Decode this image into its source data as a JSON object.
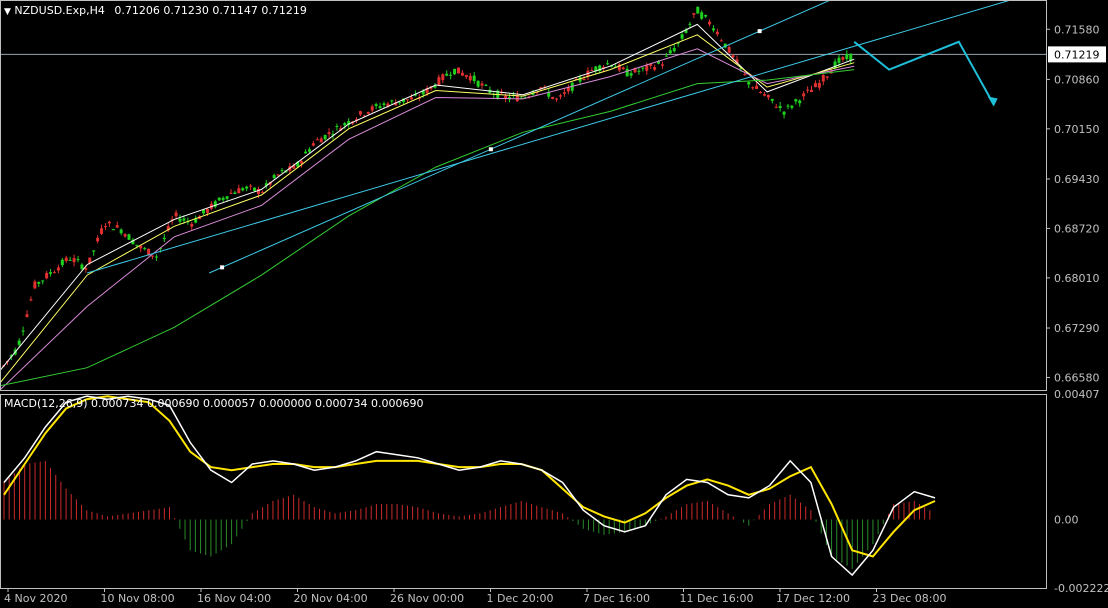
{
  "header": {
    "symbol_label": "NZDUSD.Exp,H4",
    "ohlc": "0.71206 0.71230 0.71147 0.71219"
  },
  "macd_header": "MACD(12,26,9) 0.000734 0.000690 0.000057 0.000000 0.000734 0.000690",
  "colors": {
    "background": "#000000",
    "axis": "#c0c0c0",
    "candle_up": "#e0e0e0",
    "bull_candle": "#1fd21f",
    "bear_candle": "#e03030",
    "trendline": "#3ec9e6",
    "forecast": "#1fbfd9",
    "ma_fast": "#ffffff",
    "ma_mid": "#ffff66",
    "ma_slow": "#d88ad8",
    "ma_long": "#33cc33",
    "macd_line": "#ffffff",
    "signal_line": "#ffe600",
    "hist_pos": "#cc2a2a",
    "hist_neg": "#2b8a2b"
  },
  "chart_data": [
    {
      "type": "candlestick",
      "title": "NZDUSD.Exp,H4",
      "ylim": [
        0.664,
        0.72
      ],
      "y_ticks": [
        "0.71580",
        "0.70860",
        "0.70150",
        "0.69430",
        "0.68720",
        "0.68010",
        "0.67290",
        "0.66580"
      ],
      "current_price": "0.71219",
      "x_ticks": [
        "4 Nov 2020",
        "10 Nov 08:00",
        "16 Nov 04:00",
        "20 Nov 04:00",
        "26 Nov 00:00",
        "1 Dec 20:00",
        "7 Dec 16:00",
        "11 Dec 16:00",
        "17 Dec 12:00",
        "23 Dec 08:00"
      ],
      "close_path": [
        [
          0,
          0.6668
        ],
        [
          2,
          0.67
        ],
        [
          4,
          0.679
        ],
        [
          6,
          0.681
        ],
        [
          8,
          0.683
        ],
        [
          10,
          0.6815
        ],
        [
          12,
          0.688
        ],
        [
          14,
          0.687
        ],
        [
          16,
          0.6845
        ],
        [
          18,
          0.6832
        ],
        [
          20,
          0.689
        ],
        [
          22,
          0.688
        ],
        [
          24,
          0.69
        ],
        [
          26,
          0.692
        ],
        [
          28,
          0.693
        ],
        [
          30,
          0.6925
        ],
        [
          32,
          0.695
        ],
        [
          34,
          0.696
        ],
        [
          36,
          0.6995
        ],
        [
          38,
          0.701
        ],
        [
          40,
          0.7025
        ],
        [
          42,
          0.704
        ],
        [
          44,
          0.705
        ],
        [
          46,
          0.7055
        ],
        [
          48,
          0.706
        ],
        [
          50,
          0.708
        ],
        [
          52,
          0.71
        ],
        [
          54,
          0.709
        ],
        [
          56,
          0.707
        ],
        [
          58,
          0.706
        ],
        [
          60,
          0.706
        ],
        [
          62,
          0.7075
        ],
        [
          64,
          0.7055
        ],
        [
          66,
          0.708
        ],
        [
          68,
          0.71
        ],
        [
          70,
          0.711
        ],
        [
          72,
          0.7095
        ],
        [
          74,
          0.71
        ],
        [
          76,
          0.711
        ],
        [
          78,
          0.714
        ],
        [
          80,
          0.7185
        ],
        [
          82,
          0.716
        ],
        [
          84,
          0.712
        ],
        [
          86,
          0.708
        ],
        [
          88,
          0.706
        ],
        [
          90,
          0.704
        ],
        [
          92,
          0.706
        ],
        [
          94,
          0.708
        ],
        [
          96,
          0.711
        ],
        [
          98,
          0.7121
        ]
      ],
      "series": [
        {
          "name": "Fast MA",
          "values": [
            [
              0,
              0.6668
            ],
            [
              10,
              0.682
            ],
            [
              20,
              0.6885
            ],
            [
              30,
              0.6928
            ],
            [
              40,
              0.7022
            ],
            [
              50,
              0.7078
            ],
            [
              60,
              0.7064
            ],
            [
              70,
              0.7105
            ],
            [
              80,
              0.7165
            ],
            [
              88,
              0.7068
            ],
            [
              98,
              0.7115
            ]
          ]
        },
        {
          "name": "Mid MA",
          "values": [
            [
              0,
              0.665
            ],
            [
              10,
              0.6805
            ],
            [
              20,
              0.6875
            ],
            [
              30,
              0.692
            ],
            [
              40,
              0.7015
            ],
            [
              50,
              0.707
            ],
            [
              60,
              0.7062
            ],
            [
              70,
              0.71
            ],
            [
              80,
              0.715
            ],
            [
              88,
              0.7075
            ],
            [
              98,
              0.711
            ]
          ]
        },
        {
          "name": "Slow MA",
          "values": [
            [
              0,
              0.664
            ],
            [
              10,
              0.676
            ],
            [
              20,
              0.686
            ],
            [
              30,
              0.6905
            ],
            [
              40,
              0.7
            ],
            [
              50,
              0.706
            ],
            [
              60,
              0.7058
            ],
            [
              70,
              0.709
            ],
            [
              80,
              0.713
            ],
            [
              88,
              0.708
            ],
            [
              98,
              0.7105
            ]
          ]
        },
        {
          "name": "Long MA",
          "values": [
            [
              0,
              0.6646
            ],
            [
              10,
              0.6672
            ],
            [
              20,
              0.673
            ],
            [
              30,
              0.6805
            ],
            [
              40,
              0.689
            ],
            [
              50,
              0.696
            ],
            [
              60,
              0.701
            ],
            [
              70,
              0.704
            ],
            [
              80,
              0.708
            ],
            [
              88,
              0.7085
            ],
            [
              98,
              0.71
            ]
          ]
        }
      ],
      "trendlines": [
        {
          "from": [
            24,
            0.6808
          ],
          "to": [
            98,
            0.7215
          ]
        },
        {
          "from": [
            10,
            0.6808
          ],
          "to": [
            120,
            0.7215
          ]
        }
      ],
      "forecast_path": [
        [
          98,
          0.714
        ],
        [
          102,
          0.71
        ],
        [
          106,
          0.712
        ],
        [
          110,
          0.714
        ],
        [
          114,
          0.705
        ]
      ]
    },
    {
      "type": "macd",
      "title": "MACD(12,26,9)",
      "ylim": [
        -0.002222,
        0.00407
      ],
      "y_ticks": [
        "0.00407",
        "0.00",
        "-0.002222"
      ],
      "macd": [
        0.0012,
        0.002,
        0.003,
        0.0038,
        0.004,
        0.0039,
        0.004,
        0.0039,
        0.0037,
        0.0025,
        0.0016,
        0.0012,
        0.0018,
        0.0019,
        0.0018,
        0.0016,
        0.0017,
        0.0019,
        0.0022,
        0.0021,
        0.002,
        0.0018,
        0.0016,
        0.0017,
        0.0019,
        0.0018,
        0.0016,
        0.0012,
        0.0003,
        -0.0002,
        -0.0004,
        -0.0002,
        0.0008,
        0.0013,
        0.0012,
        0.0008,
        0.0007,
        0.0011,
        0.0019,
        0.0012,
        -0.0012,
        -0.0018,
        -0.001,
        0.0004,
        0.0009,
        0.0007
      ],
      "signal": [
        0.0008,
        0.0018,
        0.0028,
        0.0036,
        0.0039,
        0.004,
        0.0039,
        0.0038,
        0.0032,
        0.0022,
        0.0017,
        0.0016,
        0.0017,
        0.0018,
        0.0018,
        0.0017,
        0.0017,
        0.0018,
        0.0019,
        0.0019,
        0.0019,
        0.0018,
        0.0017,
        0.0017,
        0.0018,
        0.0018,
        0.0016,
        0.001,
        0.0004,
        0.0001,
        -0.0001,
        0.0002,
        0.0007,
        0.0011,
        0.0013,
        0.0011,
        0.0008,
        0.001,
        0.0014,
        0.0017,
        0.0005,
        -0.001,
        -0.0012,
        -0.0004,
        0.0003,
        0.0006
      ],
      "histogram": [
        0.0012,
        0.0018,
        0.0019,
        0.001,
        0.0003,
        0.0001,
        0.0002,
        0.0003,
        0.0004,
        -0.001,
        -0.0012,
        -0.0008,
        0.0002,
        0.0006,
        0.0008,
        0.0004,
        0.0002,
        0.0003,
        0.0005,
        0.0005,
        0.0004,
        0.0002,
        0.0001,
        0.0002,
        0.0004,
        0.0006,
        0.0004,
        0.0002,
        -0.0003,
        -0.0005,
        -0.0004,
        -0.0002,
        0.0001,
        0.0005,
        0.0006,
        0.0002,
        -0.0002,
        0.0005,
        0.0008,
        0.0003,
        -0.0012,
        -0.0016,
        -0.0008,
        0.0005,
        0.0006,
        0.0002
      ]
    }
  ]
}
